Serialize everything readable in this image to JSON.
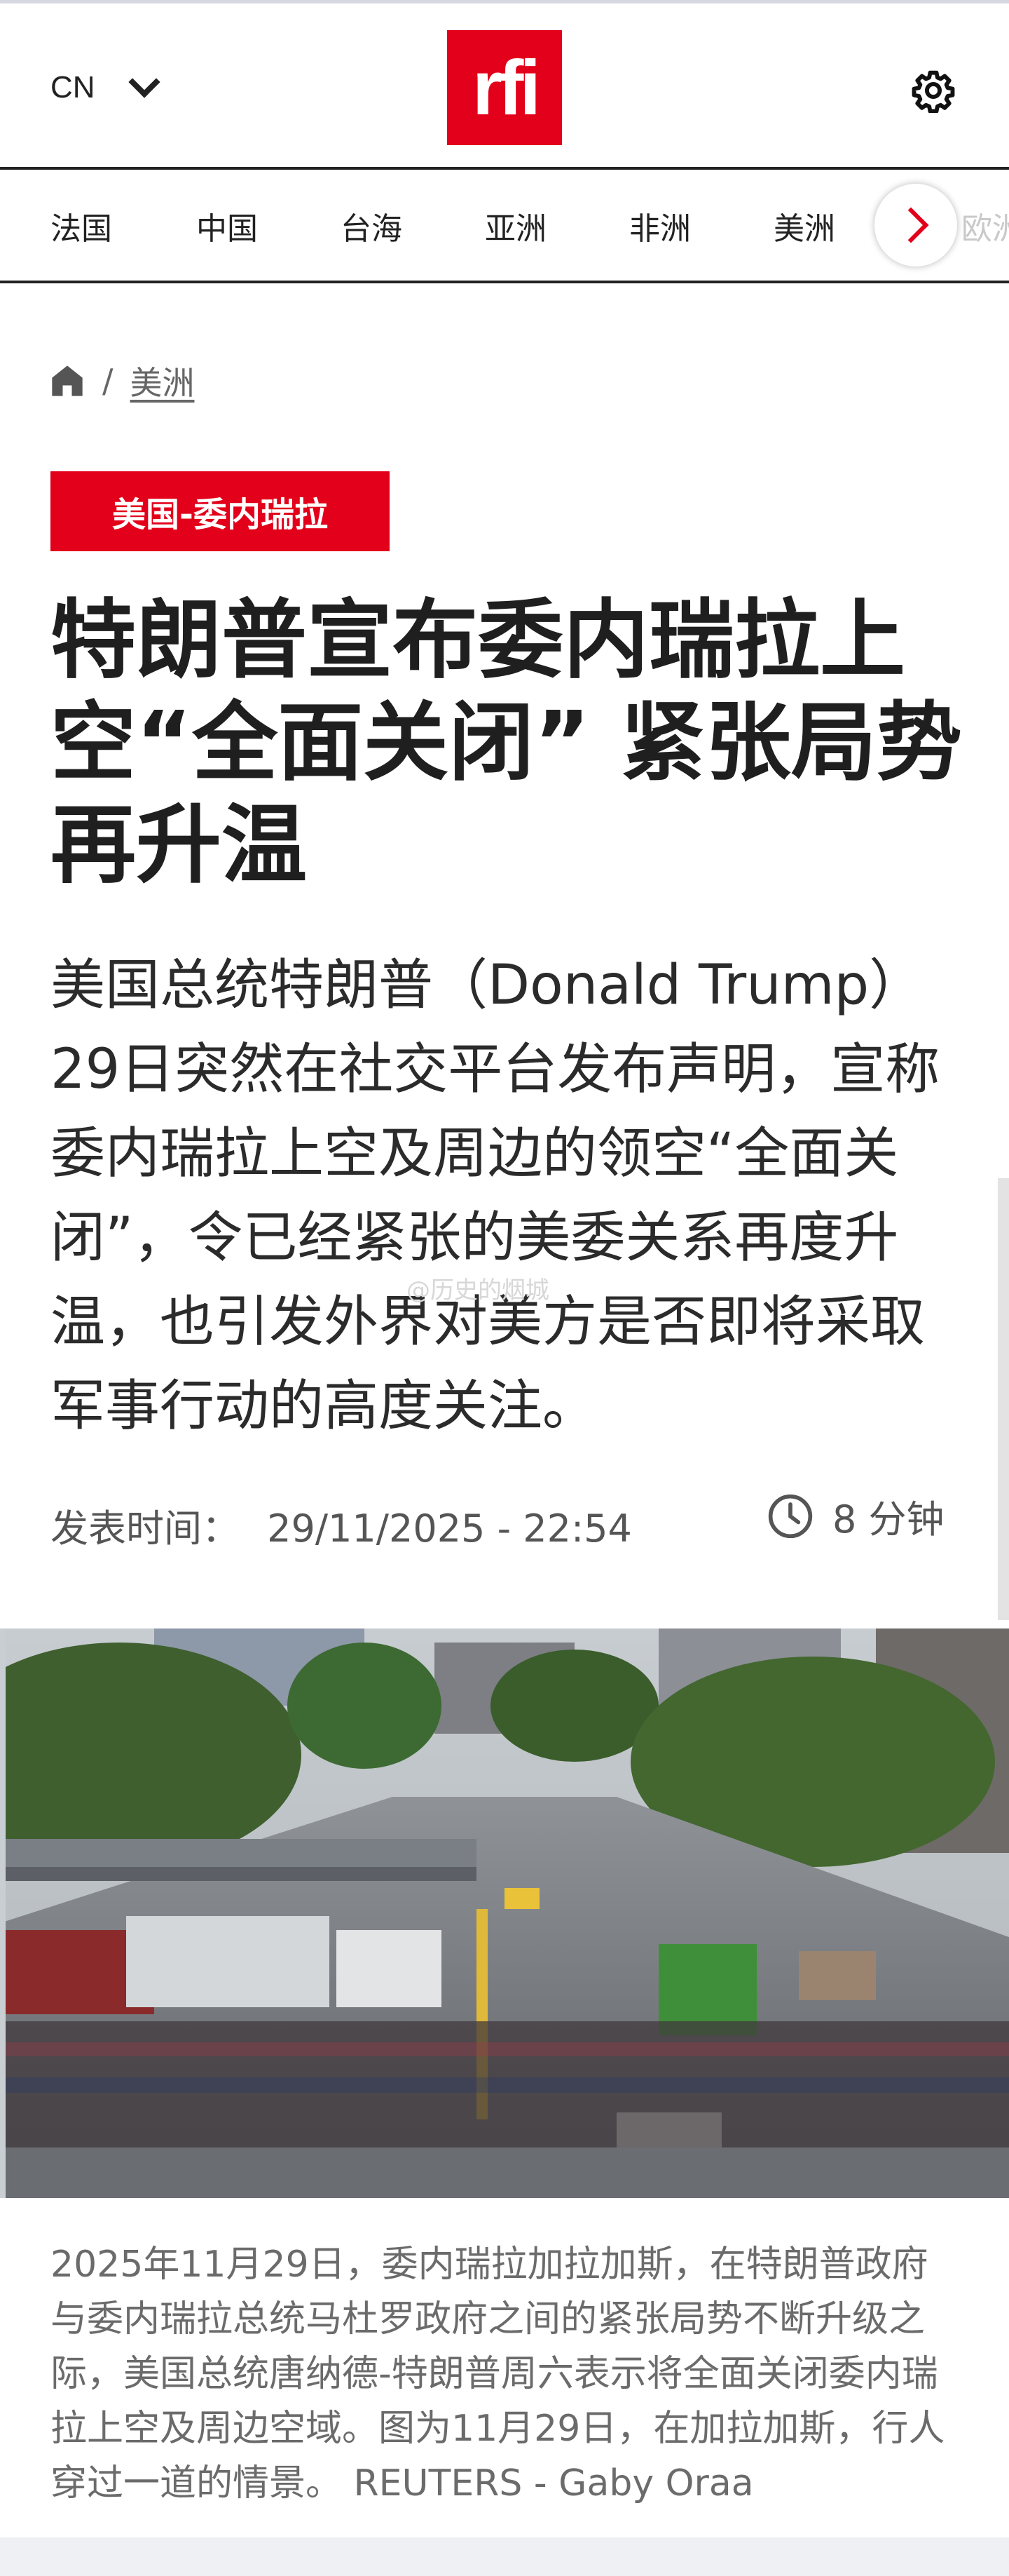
{
  "header": {
    "language": "CN",
    "logo_text": "rfi",
    "icons": [
      "chevron-down-icon",
      "gear-icon"
    ]
  },
  "nav": {
    "items": [
      "法国",
      "中国",
      "台海",
      "亚洲",
      "非洲",
      "美洲"
    ],
    "overflow_item": "欧洲"
  },
  "breadcrumb": {
    "separator": "/",
    "section": "美洲"
  },
  "article": {
    "tag": "美国-委内瑞拉",
    "title": "特朗普宣布委内瑞拉上空“全面关闭” 紧张局势再升温",
    "lead": "美国总统特朗普（Donald Trump）29日突然在社交平台发布声明，宣称委内瑞拉上空及周边的领空“全面关闭”，令已经紧张的美委关系再度升温，也引发外界对美方是否即将采取军事行动的高度关注。",
    "published_label": "发表时间：",
    "published_value": "29/11/2025 - 22:54",
    "read_time": "8 分钟",
    "caption": "2025年11月29日，委内瑞拉加拉加斯，在特朗普政府与委内瑞拉总统马杜罗政府之间的紧张局势不断升级之际，美国总统唐纳德-特朗普周六表示将全面关闭委内瑞拉上空及周边空域。图为11月29日，在加拉加斯，行人穿过一道的情景。 REUTERS - Gaby Oraa"
  },
  "watermark": "@历史的烟城",
  "colors": {
    "brand_red": "#e2001a",
    "text_dark": "#1f1f1f",
    "text_muted": "#6b6b6b"
  }
}
